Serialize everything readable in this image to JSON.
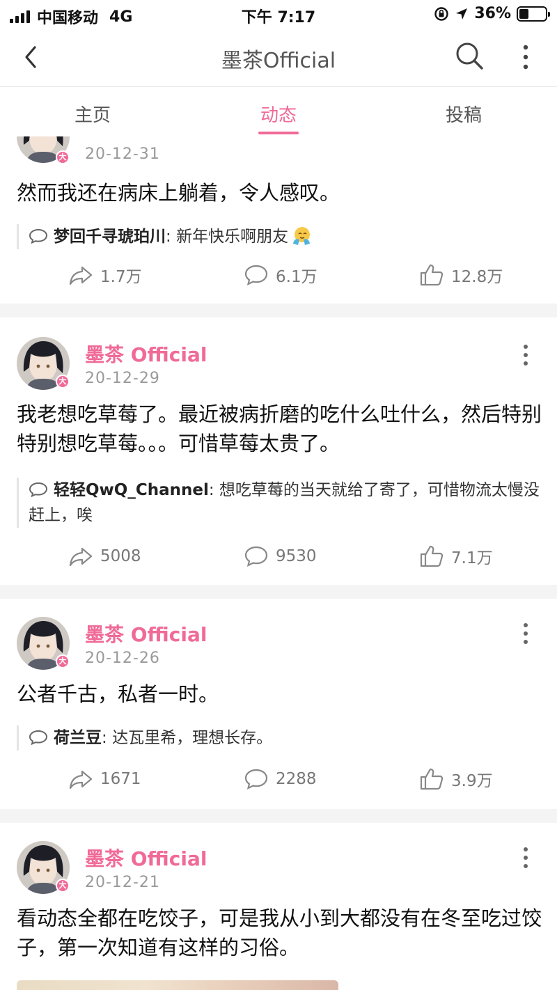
{
  "status_bar": {
    "carrier": "中国移动",
    "network": "4G",
    "time": "下午 7:17",
    "battery": "36%",
    "battery_level": 0.36
  },
  "nav": {
    "title": "墨茶Official",
    "back_icon": "chevron-left-icon",
    "search_icon": "search-icon",
    "more_icon": "vertical-ellipsis-icon"
  },
  "tabs": [
    {
      "label": "主页",
      "active": false
    },
    {
      "label": "动态",
      "active": true
    },
    {
      "label": "投稿",
      "active": false
    }
  ],
  "colors": {
    "accent": "#f06a98",
    "muted": "#999999"
  },
  "posts": [
    {
      "username": "",
      "date": "20-12-31",
      "text": "然而我还在病床上躺着，令人感叹。",
      "comment_user": "梦回千寻琥珀川",
      "comment_text": "新年快乐啊朋友",
      "share": "1.7万",
      "comments": "6.1万",
      "likes": "12.8万"
    },
    {
      "username": "墨茶 Official",
      "date": "20-12-29",
      "text": "我老想吃草莓了。最近被病折磨的吃什么吐什么，然后特别特别想吃草莓。。。可惜草莓太贵了。",
      "comment_user": "轻轻QwQ_Channel",
      "comment_text": "想吃草莓的当天就给了寄了，可惜物流太慢没赶上，唉",
      "share": "5008",
      "comments": "9530",
      "likes": "7.1万"
    },
    {
      "username": "墨茶 Official",
      "date": "20-12-26",
      "text": "公者千古，私者一时。",
      "comment_user": "荷兰豆",
      "comment_text": "达瓦里希，理想长存。",
      "share": "1671",
      "comments": "2288",
      "likes": "3.9万"
    },
    {
      "username": "墨茶 Official",
      "date": "20-12-21",
      "text": "看动态全都在吃饺子，可是我从小到大都没有在冬至吃过饺子，第一次知道有这样的习俗。"
    }
  ],
  "separator": ":",
  "badge_glyph": "大"
}
